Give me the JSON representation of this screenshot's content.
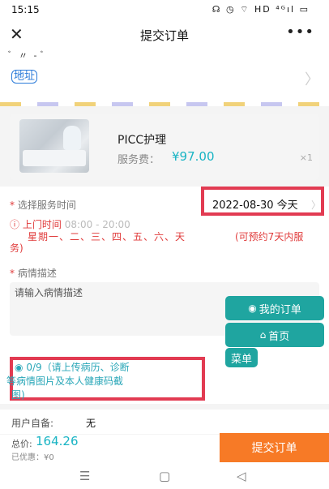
{
  "status_bar": {
    "time": "15:15",
    "icons_text": "☊ ◷ ⌔ HD ⁴ᴳıl ▭"
  },
  "header": {
    "title": "提交订单",
    "close_glyph": "✕",
    "more_glyph": "•••"
  },
  "address": {
    "cut_text": "ﾞ 〃  ‑ ﾞ",
    "label": "地址",
    "arrow_glyph": "〉"
  },
  "product": {
    "name": "PICC护理",
    "fee_label": "服务费：",
    "price": "¥97.00",
    "quantity": "×1"
  },
  "service_time": {
    "required_mark": "*",
    "label": "选择服务时间",
    "value": "2022-08-30 今天",
    "arrow_glyph": "〉"
  },
  "visit_time": {
    "icon_glyph": "ⓘ",
    "label": "上门时间",
    "value": "08:00 - 20:00",
    "weekdays": "星期一、二、三、四、五、六、天",
    "booking_note": "(可预约7天内服",
    "booking_note_wrap": "务)"
  },
  "condition": {
    "required_mark": "*",
    "label": "病情描述",
    "placeholder": "请输入病情描述"
  },
  "upload": {
    "icon_glyph": "◉",
    "line1": "0/9（请上传病历、诊断",
    "line2": "等病情图片及本人健康码截",
    "line3": "图)"
  },
  "floating_nav": {
    "my_orders_icon": "◉",
    "my_orders": "我的订单",
    "home_icon": "⌂",
    "home": "首页",
    "menu": "菜单"
  },
  "remark": {
    "label": "用户自备:",
    "value": "无"
  },
  "footer": {
    "total_label": "总价:",
    "total_value": "164.26",
    "discount_text": "已优惠：¥0",
    "submit_label": "提交订单"
  },
  "navbar": {
    "menu_glyph": "☰",
    "home_glyph": "▢",
    "back_glyph": "◁"
  },
  "colors": {
    "accent_teal": "#19b4c4",
    "float_button": "#1fa5a0",
    "submit_orange": "#f77a26",
    "warning_red": "#e03b3b",
    "highlight_box": "#e23b52"
  }
}
